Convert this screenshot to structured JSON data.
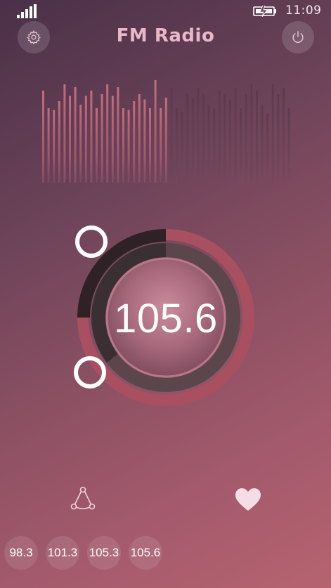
{
  "status_bar": {
    "time": "11:09",
    "signal_icon": "signal-bars-icon",
    "battery_icon": "battery-charging-icon"
  },
  "header": {
    "title": "FM Radio",
    "settings_icon": "gear-icon",
    "power_icon": "power-icon"
  },
  "tuner": {
    "frequency": "105.6",
    "dial_level": 0.55
  },
  "actions": {
    "share_icon": "share-icon",
    "favorite_icon": "heart-icon"
  },
  "presets": [
    "98.3",
    "101.3",
    "105.3",
    "105.6"
  ],
  "colors": {
    "background_start": "#4a3048",
    "background_end": "#b6636f",
    "title": "#e9b8c6",
    "ring_accent": "#a8505f",
    "ring_dark": "#2f2226"
  }
}
